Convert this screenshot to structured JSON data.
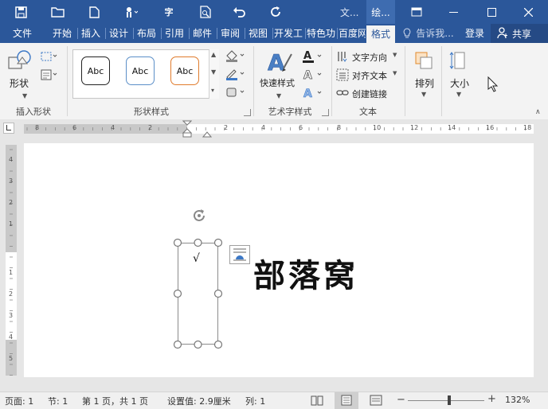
{
  "titlebar": {
    "doc_title": "文...",
    "context_title": "绘...",
    "icons": [
      "save-icon",
      "open-folder-icon",
      "new-document-icon",
      "touch-mode-icon",
      "pinyin-guide-icon",
      "print-preview-icon",
      "undo-icon",
      "redo-icon",
      "ribbon-display-icon",
      "minimize-icon",
      "maximize-icon",
      "close-icon"
    ]
  },
  "tabs": [
    {
      "label": "文件"
    },
    {
      "label": "开始"
    },
    {
      "label": "插入"
    },
    {
      "label": "设计"
    },
    {
      "label": "布局"
    },
    {
      "label": "引用"
    },
    {
      "label": "邮件"
    },
    {
      "label": "审阅"
    },
    {
      "label": "视图"
    },
    {
      "label": "开发工"
    },
    {
      "label": "特色功"
    },
    {
      "label": "百度网"
    },
    {
      "label": "格式"
    }
  ],
  "tellme": "告诉我...",
  "login": "登录",
  "share": "共享",
  "ribbon": {
    "insert_shapes": {
      "shape_label": "形状",
      "group_label": "插入形状"
    },
    "shape_styles": {
      "samples": [
        "Abc",
        "Abc",
        "Abc"
      ],
      "sample_colors": [
        "#222222",
        "#5b8fc8",
        "#e07b2c"
      ],
      "group_label": "形状样式"
    },
    "wordart": {
      "quick_styles": "快速样式",
      "group_label": "艺术字样式"
    },
    "text": {
      "direction": "文字方向",
      "align": "对齐文本",
      "link": "创建链接",
      "group_label": "文本"
    },
    "arrange": {
      "label": "排列"
    },
    "size": {
      "label": "大小"
    }
  },
  "ruler": {
    "h_numbers": [
      "8",
      "6",
      "4",
      "2",
      "",
      "2",
      "4",
      "6",
      "8",
      "10",
      "12",
      "14",
      "16",
      "18"
    ],
    "v_numbers": [
      "4",
      "3",
      "2",
      "1",
      "",
      "1",
      "2",
      "3",
      "4",
      "5"
    ]
  },
  "document": {
    "textbox_content": "√",
    "main_text": "部落窝"
  },
  "status": {
    "page": "页面: 1",
    "section": "节: 1",
    "page_of": "第 1 页，共 1 页",
    "setting": "设置值: 2.9厘米",
    "column": "列: 1",
    "zoom": "132%"
  },
  "colors": {
    "accent": "#2b579a",
    "ribbon_bg": "#f3f3f3"
  }
}
